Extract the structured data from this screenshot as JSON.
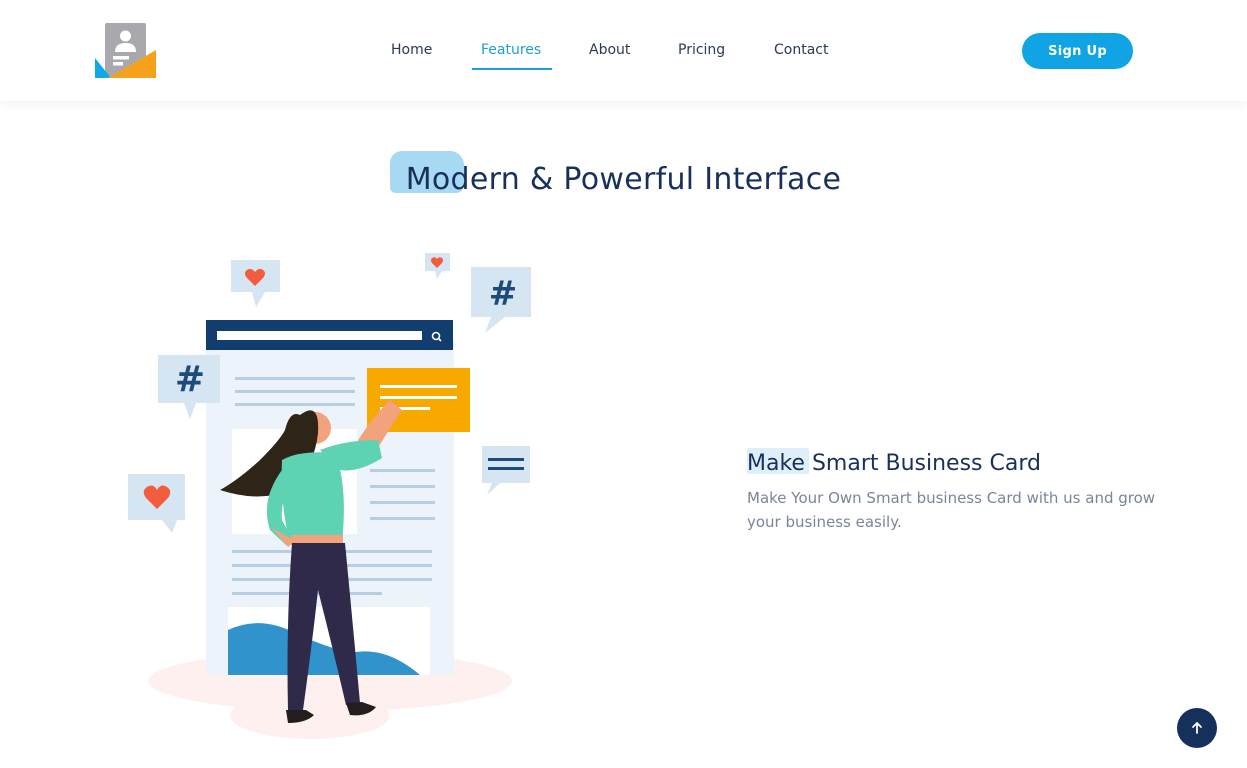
{
  "header": {
    "logo_icon": "business-card-logo-icon",
    "nav": [
      {
        "label": "Home",
        "active": false
      },
      {
        "label": "Features",
        "active": true
      },
      {
        "label": "About",
        "active": false
      },
      {
        "label": "Pricing",
        "active": false
      },
      {
        "label": "Contact",
        "active": false
      }
    ],
    "signup_label": "Sign Up"
  },
  "section": {
    "title": "Modern & Powerful Interface"
  },
  "feature": {
    "title": "Make Smart Business Card",
    "description": "Make Your Own Smart business Card with us and grow your business easily."
  },
  "back_to_top_icon": "arrow-up-icon",
  "colors": {
    "accent": "#1b9fdd",
    "button": "#10a4e5",
    "heading": "#18305b",
    "body_text": "#7a859b",
    "back_to_top": "#16305c"
  }
}
